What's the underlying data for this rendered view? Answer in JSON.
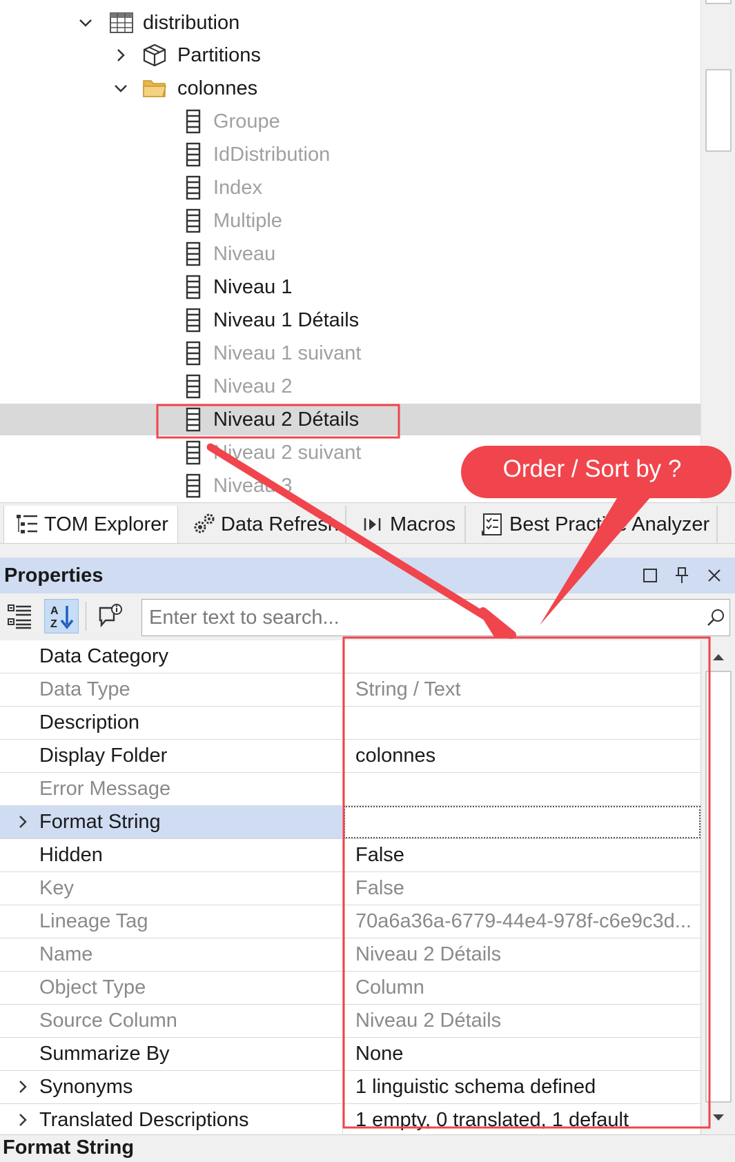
{
  "tree": {
    "table_name": "distribution",
    "partitions_label": "Partitions",
    "folder_name": "colonnes",
    "columns": [
      {
        "label": "Groupe"
      },
      {
        "label": "IdDistribution"
      },
      {
        "label": "Index"
      },
      {
        "label": "Multiple"
      },
      {
        "label": "Niveau"
      },
      {
        "label": "Niveau 1"
      },
      {
        "label": "Niveau 1 Détails"
      },
      {
        "label": "Niveau 1 suivant"
      },
      {
        "label": "Niveau 2"
      },
      {
        "label": "Niveau 2 Détails"
      },
      {
        "label": "Niveau 2 suivant"
      },
      {
        "label": "Niveau 3"
      }
    ]
  },
  "tabs": [
    {
      "label": "TOM Explorer",
      "icon": "tree-list-icon"
    },
    {
      "label": "Data Refresh",
      "icon": "gears-icon"
    },
    {
      "label": "Macros",
      "icon": "play-step-icon"
    },
    {
      "label": "Best Practice Analyzer",
      "icon": "checklist-icon"
    }
  ],
  "properties": {
    "title": "Properties",
    "search_placeholder": "Enter text to search...",
    "rows": [
      {
        "name": "Data Category",
        "value": ""
      },
      {
        "name": "Data Type",
        "value": "String / Text"
      },
      {
        "name": "Description",
        "value": ""
      },
      {
        "name": "Display Folder",
        "value": "colonnes"
      },
      {
        "name": "Error Message",
        "value": ""
      },
      {
        "name": "Format String",
        "value": ""
      },
      {
        "name": "Hidden",
        "value": "False"
      },
      {
        "name": "Key",
        "value": "False"
      },
      {
        "name": "Lineage Tag",
        "value": "70a6a36a-6779-44e4-978f-c6e9c3d..."
      },
      {
        "name": "Name",
        "value": "Niveau 2 Détails"
      },
      {
        "name": "Object Type",
        "value": "Column"
      },
      {
        "name": "Source Column",
        "value": "Niveau 2 Détails"
      },
      {
        "name": "Summarize By",
        "value": "None"
      },
      {
        "name": "Synonyms",
        "value": "1 linguistic schema defined"
      },
      {
        "name": "Translated Descriptions",
        "value": "1 empty, 0 translated, 1 default"
      }
    ],
    "footer_title": "Format String"
  },
  "annotation": {
    "callout_text": "Order  / Sort by ?",
    "color": "#f0454c"
  }
}
